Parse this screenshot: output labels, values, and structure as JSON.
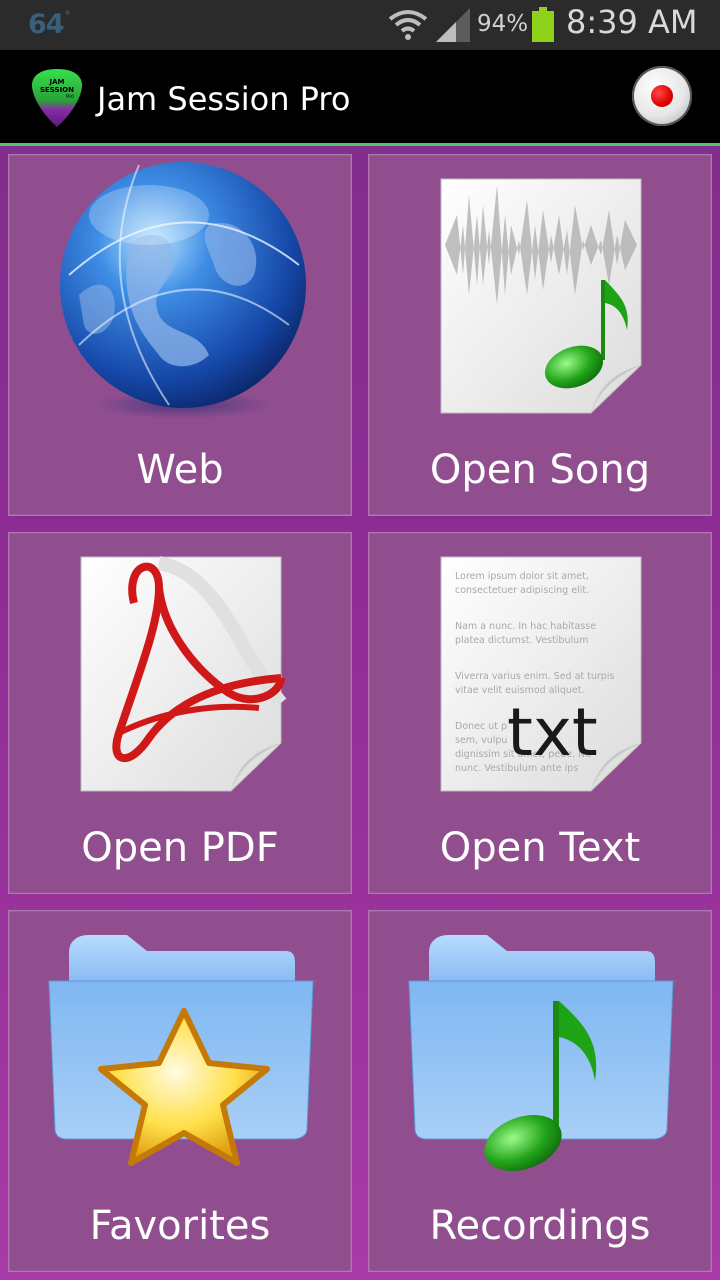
{
  "status_bar": {
    "temperature": "64",
    "battery_percent": "94%",
    "time": "8:39 AM"
  },
  "action_bar": {
    "title": "Jam Session Pro",
    "logo_text_line1": "JAM",
    "logo_text_line2": "SESSION",
    "logo_text_line3": "PRO"
  },
  "tiles": [
    {
      "label": "Web",
      "icon": "globe-icon"
    },
    {
      "label": "Open Song",
      "icon": "audio-file-icon"
    },
    {
      "label": "Open PDF",
      "icon": "pdf-file-icon"
    },
    {
      "label": "Open Text",
      "icon": "text-file-icon"
    },
    {
      "label": "Favorites",
      "icon": "favorites-folder-icon"
    },
    {
      "label": "Recordings",
      "icon": "recordings-folder-icon"
    }
  ],
  "text_file": {
    "badge": "txt",
    "lines": [
      "Lorem ipsum dolor sit amet,",
      "consectetuer adipiscing elit.",
      "Nam a nunc. In hac habitasse",
      "platea dictumst. Vestibulum",
      "Viverra varius enim. Sed at turpis",
      "vitae velit euismod aliquet.",
      "Donec ut p",
      "sem, vulpu",
      "dignissim sit amet, pede. Nu",
      "nunc. Vestibulum ante ips"
    ]
  },
  "colors": {
    "accent_green": "#4fc46d",
    "tile_purple": "#904e8f",
    "background_purple": "#8e2c94",
    "record_red": "#e10000"
  }
}
